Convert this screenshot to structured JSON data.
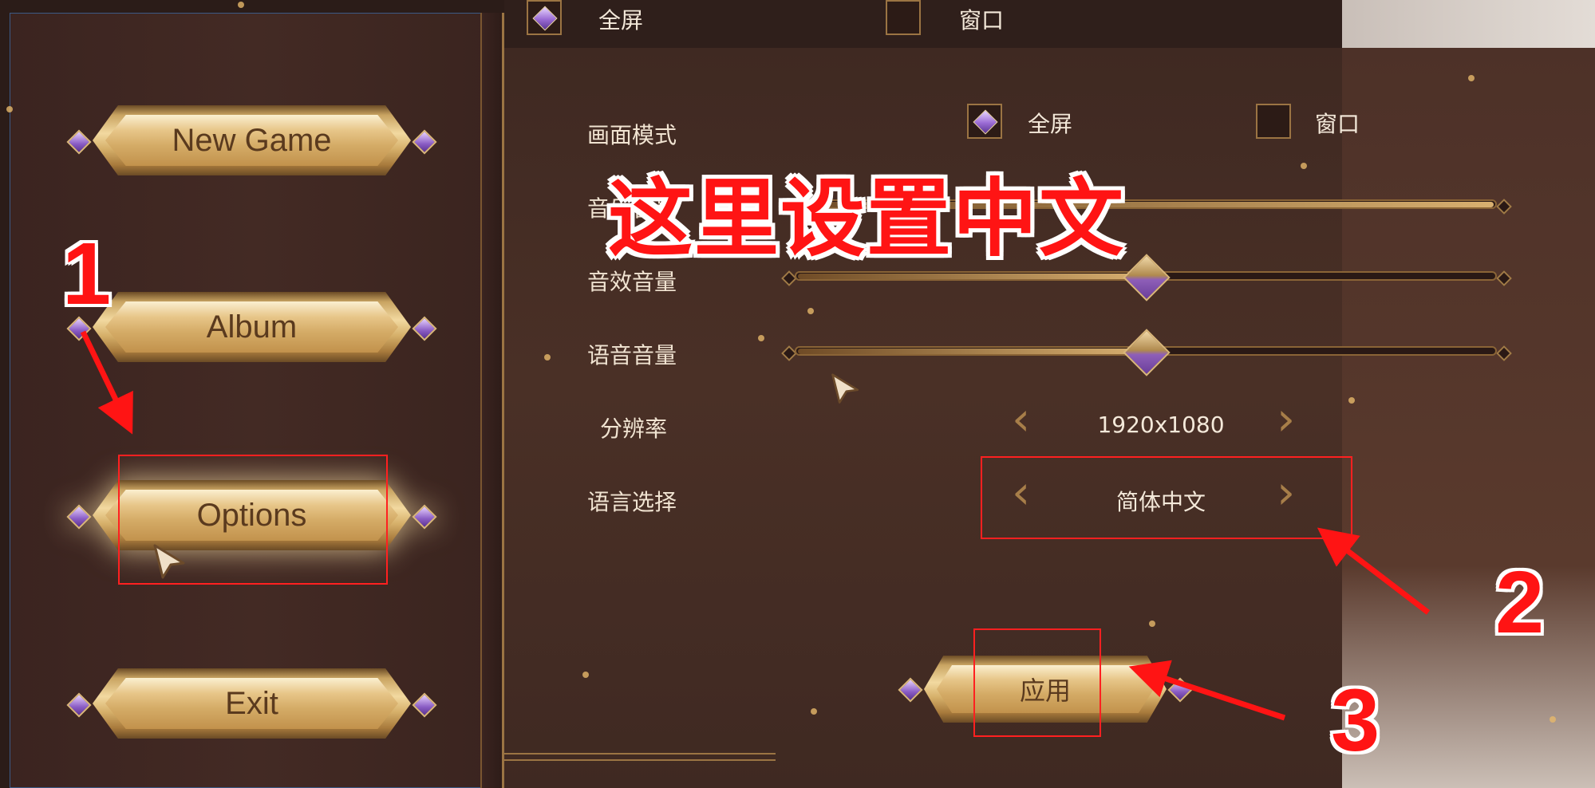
{
  "top_bar": {
    "fullscreen_label": "全屏",
    "windowed_label": "窗口"
  },
  "menu": {
    "items": [
      {
        "label": "New Game"
      },
      {
        "label": "Album"
      },
      {
        "label": "Options"
      },
      {
        "label": "Exit"
      }
    ]
  },
  "settings": {
    "display_mode": {
      "label": "画面模式",
      "fullscreen": "全屏",
      "windowed": "窗口",
      "selected": "全屏"
    },
    "music_volume": {
      "label": "音乐音量",
      "value": 1.0
    },
    "sfx_volume": {
      "label": "音效音量",
      "value": 0.5
    },
    "voice_volume": {
      "label": "语音音量",
      "value": 0.5
    },
    "resolution": {
      "label": "分辨率",
      "value": "1920x1080"
    },
    "language": {
      "label": "语言选择",
      "value": "简体中文"
    },
    "apply_label": "应用"
  },
  "annotations": {
    "title": "这里设置中文",
    "step1": "1",
    "step2": "2",
    "step3": "3",
    "accent_color": "#ff1414"
  },
  "icons": {
    "prev": "‹",
    "next": "›"
  }
}
